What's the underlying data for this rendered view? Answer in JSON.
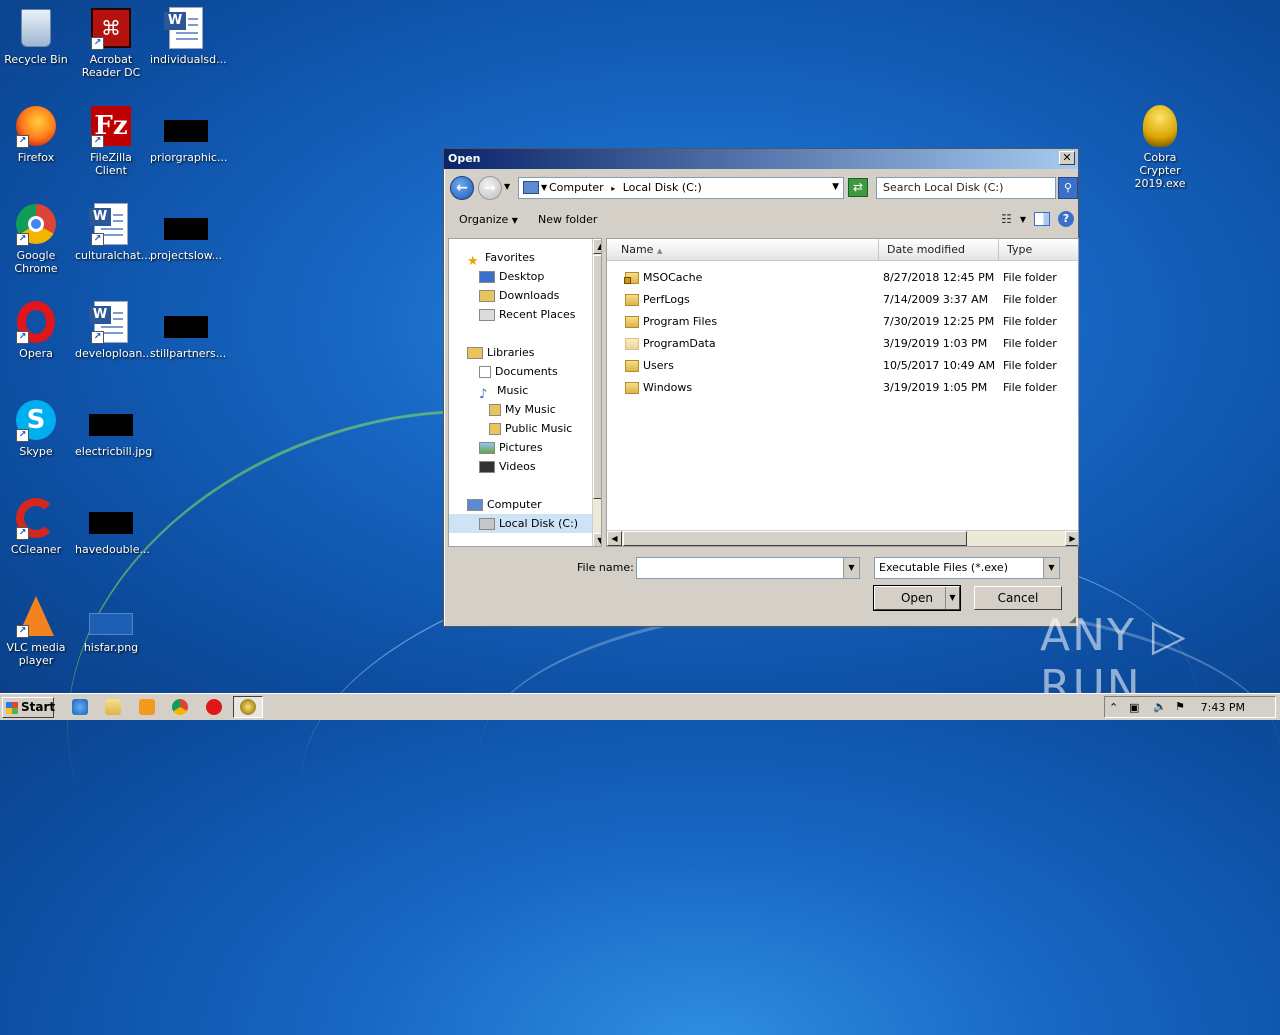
{
  "desktop": {
    "icons": [
      {
        "label": "Recycle Bin"
      },
      {
        "label": "Acrobat Reader DC"
      },
      {
        "label": "individualsd..."
      },
      {
        "label": "Firefox"
      },
      {
        "label": "FileZilla Client"
      },
      {
        "label": "priorgraphic..."
      },
      {
        "label": "Google Chrome"
      },
      {
        "label": "culturalchat..."
      },
      {
        "label": "projectslow..."
      },
      {
        "label": "Opera"
      },
      {
        "label": "developloan..."
      },
      {
        "label": "stillpartners..."
      },
      {
        "label": "Skype"
      },
      {
        "label": "electricbill.jpg"
      },
      {
        "label": "CCleaner"
      },
      {
        "label": "havedouble..."
      },
      {
        "label": "VLC media player"
      },
      {
        "label": "hisfar.png"
      },
      {
        "label": "Cobra Crypter 2019.exe"
      }
    ]
  },
  "dialog": {
    "title": "Open",
    "close_label": "✕",
    "address": {
      "computer": "Computer",
      "sep": "▸",
      "disk": "Local Disk (C:)"
    },
    "search_placeholder": "Search Local Disk (C:)",
    "toolbar": {
      "organize": "Organize",
      "new_folder": "New folder"
    },
    "nav": {
      "favorites": "Favorites",
      "desktop": "Desktop",
      "downloads": "Downloads",
      "recent": "Recent Places",
      "libraries": "Libraries",
      "documents": "Documents",
      "music": "Music",
      "my_music": "My Music",
      "public_music": "Public Music",
      "pictures": "Pictures",
      "videos": "Videos",
      "computer": "Computer",
      "local_disk": "Local Disk (C:)"
    },
    "columns": {
      "name": "Name",
      "date": "Date modified",
      "type": "Type"
    },
    "files": [
      {
        "name": "MSOCache",
        "date": "8/27/2018 12:45 PM",
        "type": "File folder"
      },
      {
        "name": "PerfLogs",
        "date": "7/14/2009 3:37 AM",
        "type": "File folder"
      },
      {
        "name": "Program Files",
        "date": "7/30/2019 12:25 PM",
        "type": "File folder"
      },
      {
        "name": "ProgramData",
        "date": "3/19/2019 1:03 PM",
        "type": "File folder"
      },
      {
        "name": "Users",
        "date": "10/5/2017 10:49 AM",
        "type": "File folder"
      },
      {
        "name": "Windows",
        "date": "3/19/2019 1:05 PM",
        "type": "File folder"
      }
    ],
    "file_name_label": "File name:",
    "file_name_value": "",
    "filter": "Executable Files (*.exe)",
    "open_label": "Open",
    "cancel_label": "Cancel"
  },
  "taskbar": {
    "start": "Start",
    "clock": "7:43 PM"
  },
  "watermark": "ANY ▷ RUN"
}
